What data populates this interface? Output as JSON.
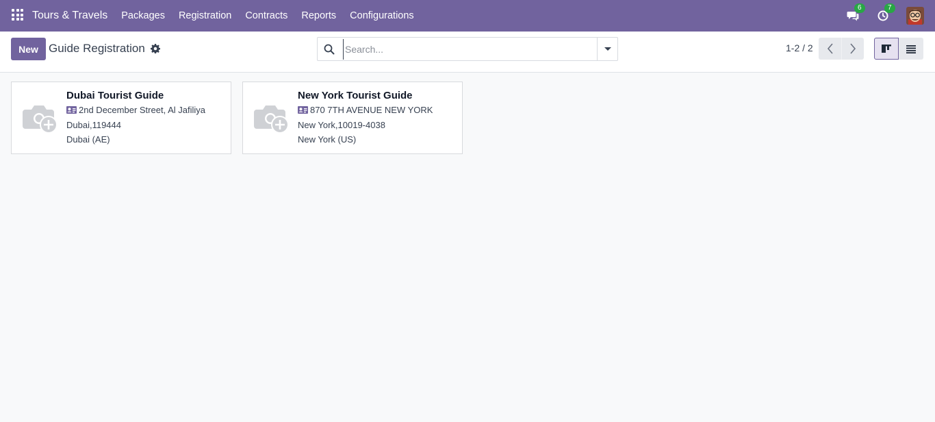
{
  "navbar": {
    "brand": "Tours & Travels",
    "menu": [
      "Packages",
      "Registration",
      "Contracts",
      "Reports",
      "Configurations"
    ],
    "messages_count": "6",
    "activities_count": "7",
    "bg_color": "#71639e"
  },
  "control": {
    "new_label": "New",
    "title": "Guide Registration",
    "search_placeholder": "Search...",
    "pager": "1-2 / 2"
  },
  "cards": [
    {
      "name": "Dubai Tourist Guide",
      "street": "2nd December Street, Al Jafiliya",
      "city_zip": "Dubai,119444",
      "state_country": "Dubai (AE)"
    },
    {
      "name": "New York Tourist Guide",
      "street": "870 7TH AVENUE NEW YORK",
      "city_zip": "New York,10019-4038",
      "state_country": "New York (US)"
    }
  ],
  "icons": {
    "apps": "apps-grid-icon",
    "messages": "chat-bubbles-icon",
    "activities": "clock-icon",
    "settings": "gear-icon",
    "search": "search-icon",
    "card_image": "camera-plus-icon",
    "address": "id-card-icon"
  }
}
